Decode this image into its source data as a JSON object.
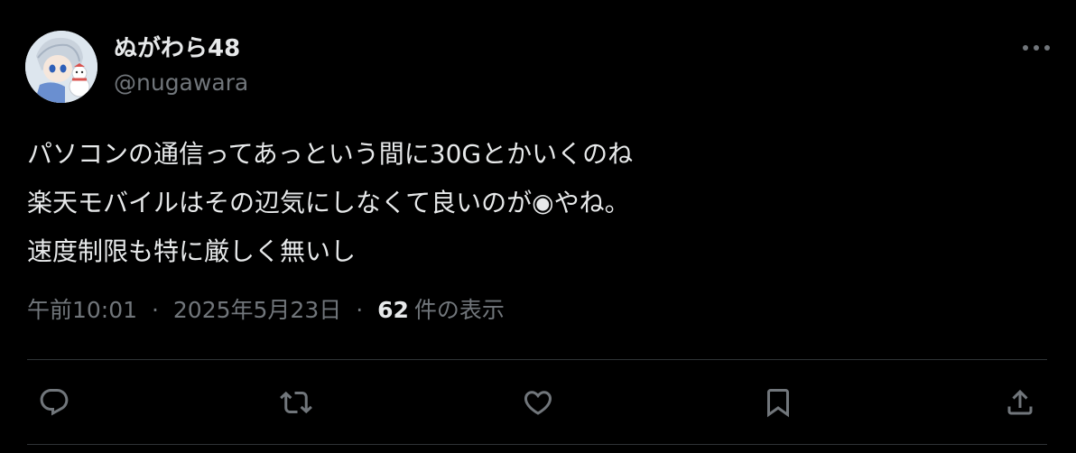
{
  "author": {
    "display_name": "ぬがわら48",
    "handle": "@nugawara"
  },
  "tweet": {
    "lines": [
      "パソコンの通信ってあっという間に30Gとかいくのね",
      "楽天モバイルはその辺気にしなくて良いのが◉やね。",
      "速度制限も特に厳しく無いし"
    ]
  },
  "meta": {
    "time": "午前10:01",
    "separator": "·",
    "date": "2025年5月23日",
    "views_count": "62",
    "views_label": "件の表示"
  },
  "icons": {
    "more": "more-icon",
    "reply": "reply-icon",
    "retweet": "retweet-icon",
    "like": "like-icon",
    "bookmark": "bookmark-icon",
    "share": "share-icon"
  },
  "colors": {
    "background": "#000000",
    "text": "#e7e9ea",
    "secondary": "#71767b",
    "divider": "#2f3336"
  }
}
